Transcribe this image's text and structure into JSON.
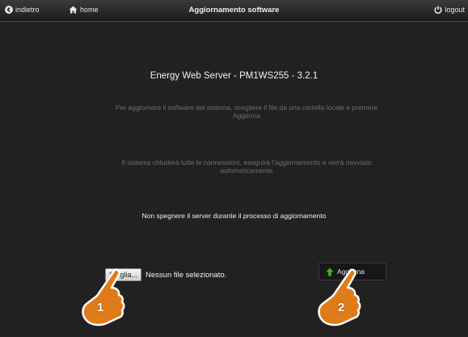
{
  "topbar": {
    "back_label": "indietro",
    "home_label": "home",
    "title": "Aggiornamento software",
    "logout_label": "logout"
  },
  "main": {
    "header": "Energy Web Server - PM1WS255 - 3.2.1",
    "instructions": "Per aggiornare il software del sistema, scegliere il file da una cartella locale e premere Aggiorna",
    "info": "Il sistema chiuderà tutte le connessioni, eseguirà l'aggiornamento e verrà riavviato automaticamente",
    "warning": "Non spegnere il server durante il processo di aggiornamento"
  },
  "file_input": {
    "browse_label": "Sfoglia...",
    "status": "Nessun file selezionato."
  },
  "update_button": {
    "label": "Aggiorna",
    "icon": "green-up-arrow-icon"
  },
  "callouts": {
    "step1": "1",
    "step2": "2",
    "color": "#e07b1a"
  },
  "colors": {
    "background": "#202020",
    "text": "#f2f2f2",
    "dim_text": "#6e6e6e",
    "arrow": "#4caf27"
  }
}
